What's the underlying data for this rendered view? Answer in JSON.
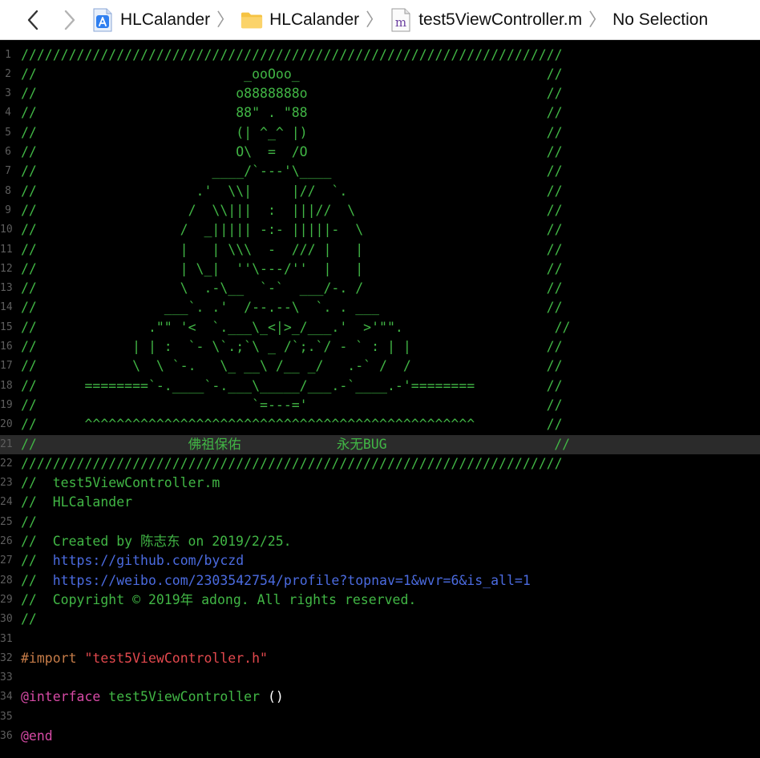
{
  "breadcrumb": {
    "back_icon": "chevron-left-icon",
    "forward_icon": "chevron-right-icon",
    "project": "HLCalander",
    "folder": "HLCalander",
    "file": "test5ViewController.m",
    "selection": "No Selection",
    "separator": "〉"
  },
  "colors": {
    "comment": "#41b645",
    "url": "#4b6be0",
    "preprocessor": "#c67c48",
    "string": "#e2484d",
    "keyword": "#d64aa5",
    "plain": "#ffffff"
  },
  "lines": [
    {
      "n": "1",
      "segs": [
        {
          "c": "c",
          "t": "////////////////////////////////////////////////////////////////////"
        }
      ]
    },
    {
      "n": "2",
      "segs": [
        {
          "c": "c",
          "t": "//                          _ooOoo_                               //"
        }
      ]
    },
    {
      "n": "3",
      "segs": [
        {
          "c": "c",
          "t": "//                         o8888888o                              //"
        }
      ]
    },
    {
      "n": "4",
      "segs": [
        {
          "c": "c",
          "t": "//                         88\" . \"88                              //"
        }
      ]
    },
    {
      "n": "5",
      "segs": [
        {
          "c": "c",
          "t": "//                         (| ^_^ |)                              //"
        }
      ]
    },
    {
      "n": "6",
      "segs": [
        {
          "c": "c",
          "t": "//                         O\\  =  /O                              //"
        }
      ]
    },
    {
      "n": "7",
      "segs": [
        {
          "c": "c",
          "t": "//                      ____/`---'\\____                           //"
        }
      ]
    },
    {
      "n": "8",
      "segs": [
        {
          "c": "c",
          "t": "//                    .'  \\\\|     |//  `.                         //"
        }
      ]
    },
    {
      "n": "9",
      "segs": [
        {
          "c": "c",
          "t": "//                   /  \\\\|||  :  |||//  \\                        //"
        }
      ]
    },
    {
      "n": "10",
      "segs": [
        {
          "c": "c",
          "t": "//                  /  _||||| -:- |||||-  \\                       //"
        }
      ]
    },
    {
      "n": "11",
      "segs": [
        {
          "c": "c",
          "t": "//                  |   | \\\\\\  -  /// |   |                       //"
        }
      ]
    },
    {
      "n": "12",
      "segs": [
        {
          "c": "c",
          "t": "//                  | \\_|  ''\\---/''  |   |                       //"
        }
      ]
    },
    {
      "n": "13",
      "segs": [
        {
          "c": "c",
          "t": "//                  \\  .-\\__  `-`  ___/-. /                       //"
        }
      ]
    },
    {
      "n": "14",
      "segs": [
        {
          "c": "c",
          "t": "//                ___`. .'  /--.--\\  `. . ___                     //"
        }
      ]
    },
    {
      "n": "15",
      "segs": [
        {
          "c": "c",
          "t": "//              .\"\" '<  `.___\\_<|>_/___.'  >'\"\".                   //"
        }
      ]
    },
    {
      "n": "16",
      "segs": [
        {
          "c": "c",
          "t": "//            | | :  `- \\`.;`\\ _ /`;.`/ - ` : | |                 //"
        }
      ]
    },
    {
      "n": "17",
      "segs": [
        {
          "c": "c",
          "t": "//            \\  \\ `-.   \\_ __\\ /__ _/   .-` /  /                 //"
        }
      ]
    },
    {
      "n": "18",
      "segs": [
        {
          "c": "c",
          "t": "//      ========`-.____`-.___\\_____/___.-`____.-'========         //"
        }
      ]
    },
    {
      "n": "19",
      "segs": [
        {
          "c": "c",
          "t": "//                           `=---='                              //"
        }
      ]
    },
    {
      "n": "20",
      "segs": [
        {
          "c": "c",
          "t": "//      ^^^^^^^^^^^^^^^^^^^^^^^^^^^^^^^^^^^^^^^^^^^^^^^^^         //"
        }
      ]
    },
    {
      "n": "21",
      "hl": true,
      "segs": [
        {
          "c": "c",
          "t": "//                   佛祖保佑            永无BUG                     //"
        }
      ]
    },
    {
      "n": "22",
      "segs": [
        {
          "c": "c",
          "t": "////////////////////////////////////////////////////////////////////"
        }
      ]
    },
    {
      "n": "23",
      "segs": [
        {
          "c": "c",
          "t": "//  test5ViewController.m"
        }
      ]
    },
    {
      "n": "24",
      "segs": [
        {
          "c": "c",
          "t": "//  HLCalander"
        }
      ]
    },
    {
      "n": "25",
      "segs": [
        {
          "c": "c",
          "t": "//"
        }
      ]
    },
    {
      "n": "26",
      "segs": [
        {
          "c": "c",
          "t": "//  Created by 陈志东 on 2019/2/25."
        }
      ]
    },
    {
      "n": "27",
      "segs": [
        {
          "c": "c",
          "t": "//  "
        },
        {
          "c": "url",
          "t": "https://github.com/byczd"
        }
      ]
    },
    {
      "n": "28",
      "segs": [
        {
          "c": "c",
          "t": "//  "
        },
        {
          "c": "url",
          "t": "https://weibo.com/2303542754/profile?topnav=1&wvr=6&is_all=1"
        }
      ]
    },
    {
      "n": "29",
      "segs": [
        {
          "c": "c",
          "t": "//  Copyright © 2019年 adong. All rights reserved."
        }
      ]
    },
    {
      "n": "30",
      "segs": [
        {
          "c": "c",
          "t": "//"
        }
      ]
    },
    {
      "n": "31",
      "segs": []
    },
    {
      "n": "32",
      "segs": [
        {
          "c": "pre",
          "t": "#import "
        },
        {
          "c": "str",
          "t": "\"test5ViewController.h\""
        }
      ]
    },
    {
      "n": "33",
      "segs": []
    },
    {
      "n": "34",
      "segs": [
        {
          "c": "kw",
          "t": "@interface"
        },
        {
          "c": "plain",
          "t": " "
        },
        {
          "c": "c",
          "t": "test5ViewController"
        },
        {
          "c": "plain",
          "t": " ()"
        }
      ]
    },
    {
      "n": "35",
      "segs": []
    },
    {
      "n": "36",
      "segs": [
        {
          "c": "kw",
          "t": "@end"
        }
      ]
    }
  ]
}
